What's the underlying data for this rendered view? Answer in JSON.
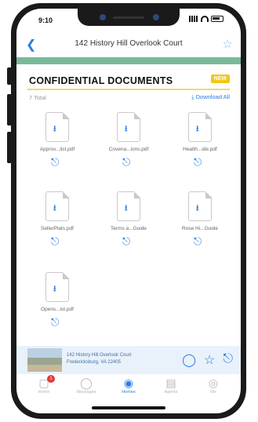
{
  "status_bar": {
    "time": "9:10"
  },
  "header": {
    "back_icon": "chevron-left-icon",
    "title": "142 History Hill Overlook Court",
    "star_icon": "star-outline-icon"
  },
  "section": {
    "title": "CONFIDENTIAL DOCUMENTS",
    "badge": "NEW",
    "total": "7 Total",
    "download_all": "⤓ Download All"
  },
  "documents": [
    {
      "name": "Approv...list.pdf"
    },
    {
      "name": "Covena...ions.pdf"
    },
    {
      "name": "Health...ide.pdf"
    },
    {
      "name": "SellerPlats.pdf"
    },
    {
      "name": "Terms a...Guide"
    },
    {
      "name": "Rose Hi...Guide"
    },
    {
      "name": "Opens...ist.pdf"
    }
  ],
  "listing": {
    "line1": "142 History Hill Overlook Court",
    "line2": "Fredericksburg, VA 22405"
  },
  "tabs": [
    {
      "label": "Home",
      "icon": "home-icon",
      "badge": "1"
    },
    {
      "label": "Messages",
      "icon": "chat-icon"
    },
    {
      "label": "Homes",
      "icon": "map-pin-icon",
      "active": true
    },
    {
      "label": "Agents",
      "icon": "id-card-icon"
    },
    {
      "label": "Me",
      "icon": "globe-icon"
    }
  ],
  "colors": {
    "accent": "#2a7de1",
    "green_bar": "#7bb89a",
    "badge": "#f5c518"
  }
}
